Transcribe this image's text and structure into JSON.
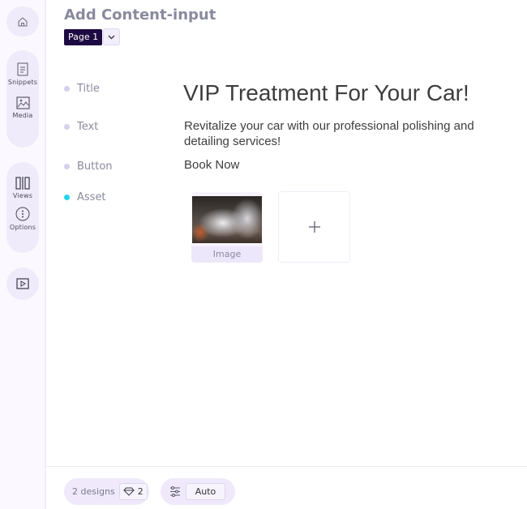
{
  "sidebar": {
    "items": [
      {
        "icon": "home-icon",
        "label": ""
      },
      {
        "icon": "snippets-icon",
        "label": "Snippets"
      },
      {
        "icon": "media-icon",
        "label": "Media"
      },
      {
        "icon": "views-icon",
        "label": "Views"
      },
      {
        "icon": "options-icon",
        "label": "Options"
      },
      {
        "icon": "play-icon",
        "label": ""
      }
    ]
  },
  "header": {
    "title": "Add Content-input",
    "page_selector": "Page 1"
  },
  "fields": [
    {
      "label": "Title",
      "active": false
    },
    {
      "label": "Text",
      "active": false
    },
    {
      "label": "Button",
      "active": false
    },
    {
      "label": "Asset",
      "active": true
    }
  ],
  "content": {
    "title": "VIP Treatment For Your Car!",
    "text": "Revitalize your car with our professional polishing and detailing services!",
    "button": "Book Now",
    "assets": [
      {
        "type": "Image",
        "description": "car being washed with foam spray"
      }
    ],
    "add_asset_icon": "plus-icon"
  },
  "footer": {
    "designs_label": "2 designs",
    "designs_count": "2",
    "mode_value": "Auto"
  },
  "colors": {
    "accent_dark": "#1e0a42",
    "active_dot": "#1fd6e8",
    "inactive_dot": "#d7d0ea",
    "pill_bg": "#efe9fb"
  }
}
